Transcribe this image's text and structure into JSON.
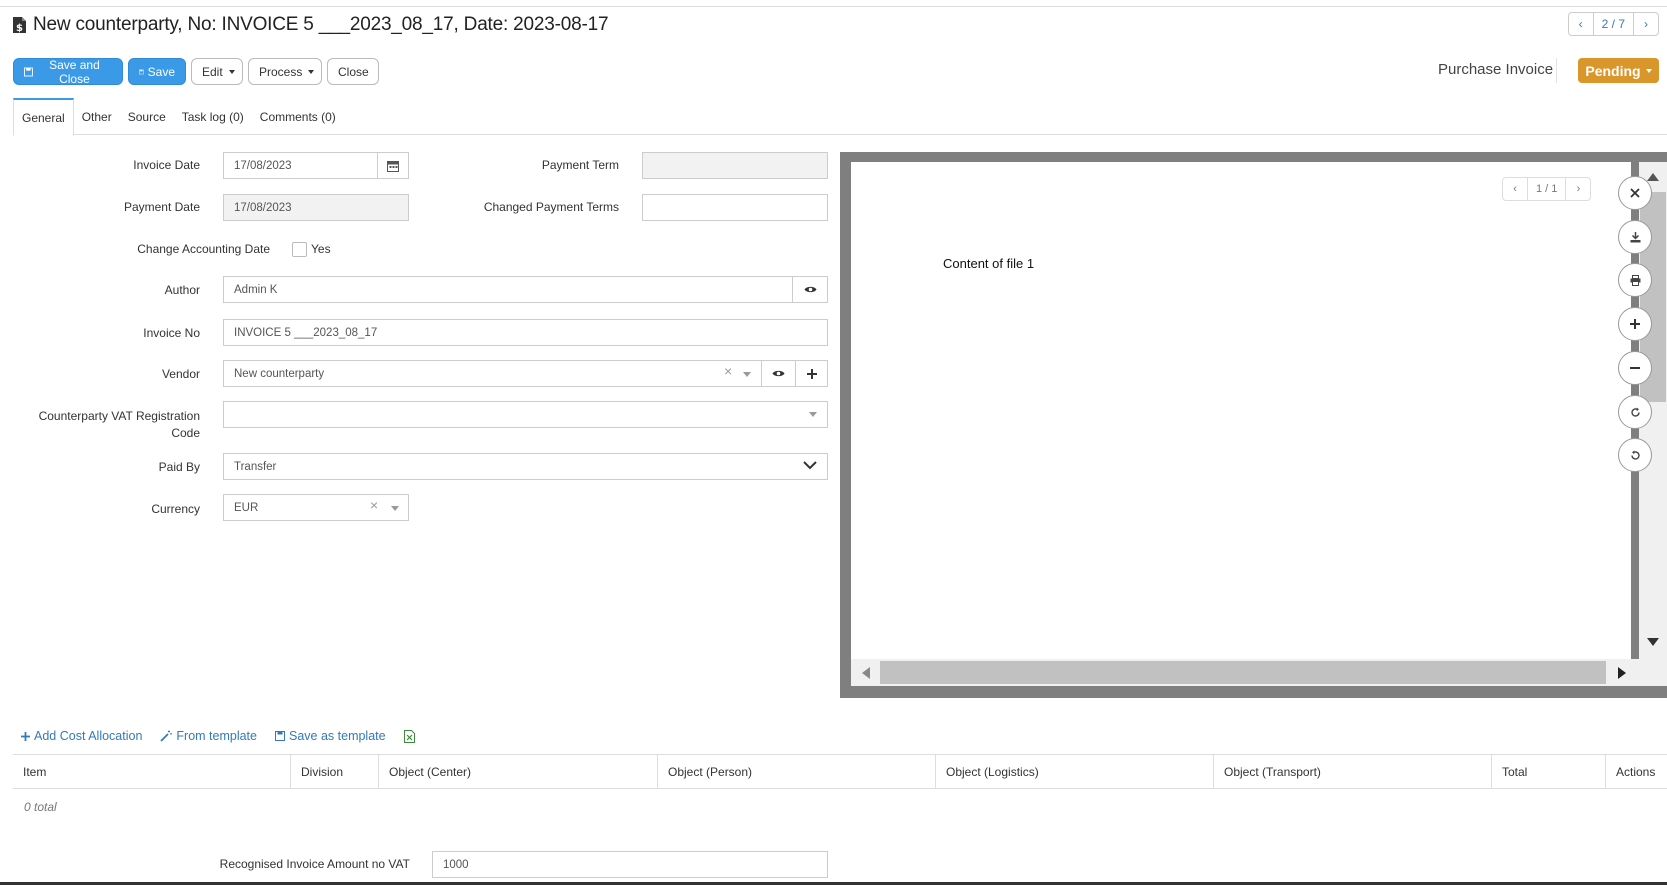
{
  "header": {
    "title": "New counterparty, No: INVOICE 5 ___2023_08_17, Date: 2023-08-17",
    "pager": "2 / 7"
  },
  "toolbar": {
    "save_close": "Save and Close",
    "save": "Save",
    "edit": "Edit",
    "process": "Process",
    "close": "Close"
  },
  "doc_type": "Purchase Invoice",
  "status": {
    "label": "Pending",
    "color": "#d9962b"
  },
  "tabs": [
    {
      "label": "General",
      "active": true
    },
    {
      "label": "Other"
    },
    {
      "label": "Source"
    },
    {
      "label": "Task log (0)"
    },
    {
      "label": "Comments (0)"
    }
  ],
  "form": {
    "invoice_date": {
      "label": "Invoice Date",
      "value": "17/08/2023"
    },
    "payment_date": {
      "label": "Payment Date",
      "value": "17/08/2023"
    },
    "payment_term": {
      "label": "Payment Term",
      "value": ""
    },
    "changed_payment_terms": {
      "label": "Changed Payment Terms",
      "value": ""
    },
    "change_accounting_date": {
      "label": "Change Accounting Date",
      "option": "Yes",
      "checked": false
    },
    "author": {
      "label": "Author",
      "value": "Admin K"
    },
    "invoice_no": {
      "label": "Invoice No",
      "value": "INVOICE 5 ___2023_08_17"
    },
    "vendor": {
      "label": "Vendor",
      "value": "New counterparty"
    },
    "vat_code": {
      "label_line1": "Counterparty VAT Registration",
      "label_line2": "Code",
      "value": ""
    },
    "paid_by": {
      "label": "Paid By",
      "value": "Transfer"
    },
    "currency": {
      "label": "Currency",
      "value": "EUR"
    }
  },
  "viewer": {
    "page_counter": "1 / 1",
    "content": "Content of file 1"
  },
  "allocation": {
    "add": "Add Cost Allocation",
    "from_template": "From template",
    "save_template": "Save as template",
    "columns": [
      "Item",
      "Division",
      "Object (Center)",
      "Object (Person)",
      "Object (Logistics)",
      "Object (Transport)",
      "Total",
      "Actions"
    ],
    "total_text": "0 total"
  },
  "recognised": {
    "label": "Recognised Invoice Amount no VAT",
    "value": "1000"
  }
}
